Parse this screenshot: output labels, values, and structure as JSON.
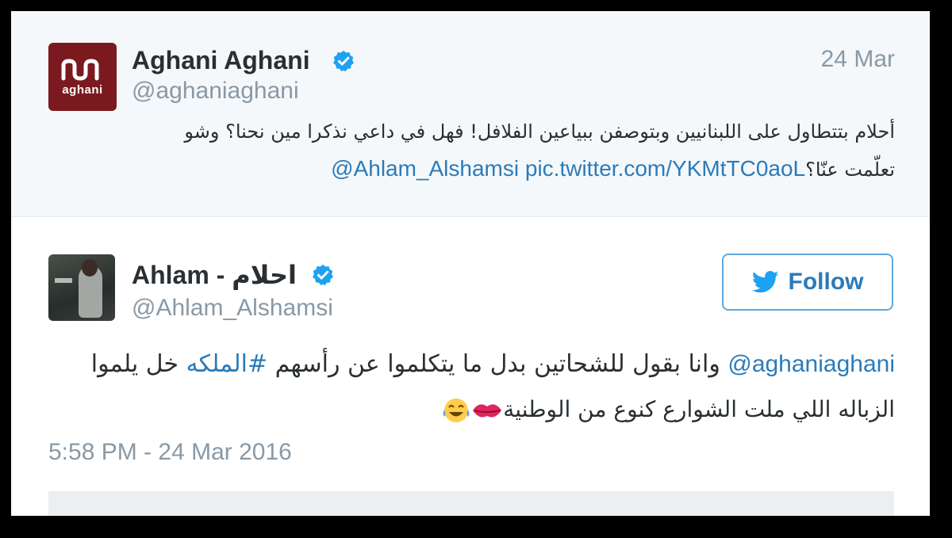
{
  "quoted_tweet": {
    "name": "Aghani Aghani",
    "handle": "@aghaniaghani",
    "date": "24 Mar",
    "avatar_text": "aghani",
    "text_line1": "أحلام بتتطاول على اللبنانيين وبتوصفن ببياعين الفلافل! فهل في داعي نذكرا مين نحنا؟ وشو",
    "text_line2_arabic": "تعلّمت عنّا؟",
    "text_line2_mention": "@Ahlam_Alshamsi",
    "text_line2_link": "pic.twitter.com/YKMtTC0aoL"
  },
  "main_tweet": {
    "name": "Ahlam - احلام",
    "handle": "@Ahlam_Alshamsi",
    "follow_label": "Follow",
    "mention": "@aghaniaghani",
    "text_line1_a": "وانا بقول للشحاتين بدل ما يتكلموا عن رأسهم",
    "hashtag": "#الملكه",
    "text_line1_b": "خل يلموا",
    "text_line2": "الزباله اللي ملت الشوارع كنوع من الوطنية",
    "emoji_names": [
      "kiss-mark-icon",
      "tears-of-joy-icon"
    ],
    "timestamp": "5:58 PM - 24 Mar 2016"
  },
  "colors": {
    "accent": "#1da1f2",
    "link": "#2b7bb9",
    "muted": "#8899a6",
    "text": "#292f33",
    "quoted_bg": "#f5f8fa",
    "aghani_brand": "#7a1a1f"
  }
}
